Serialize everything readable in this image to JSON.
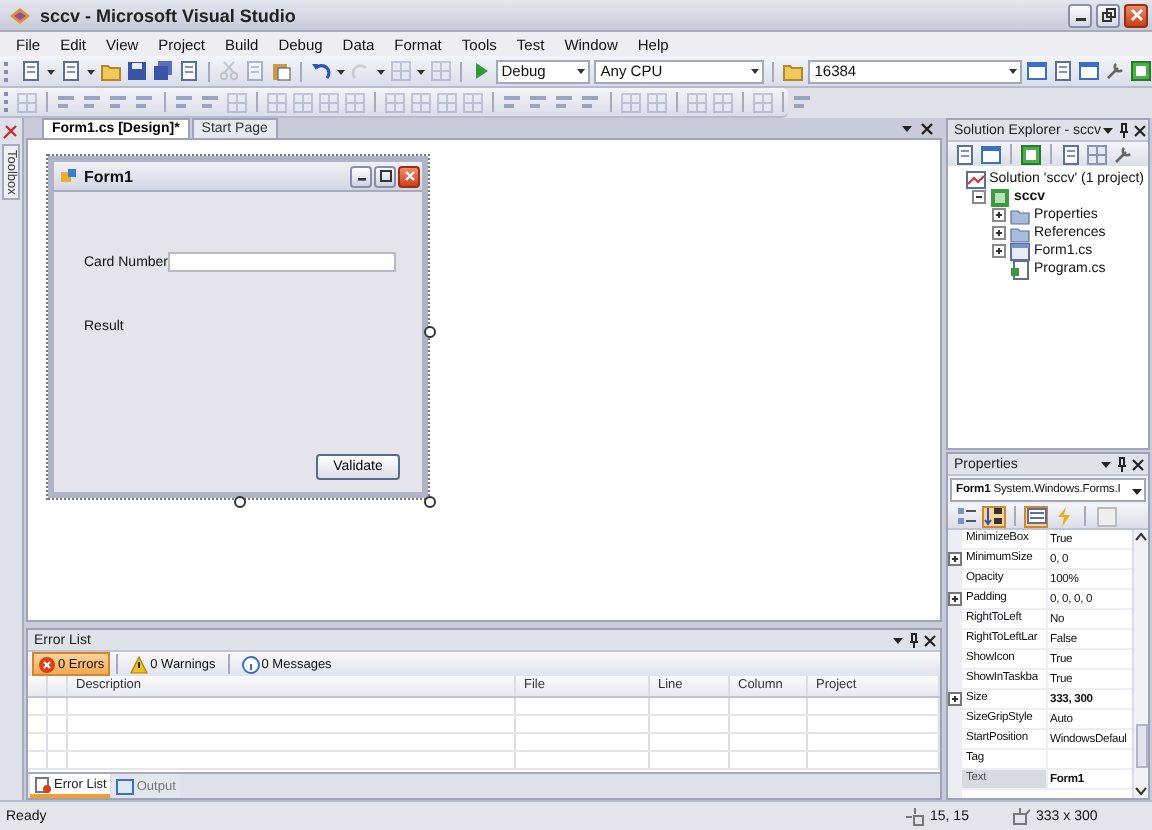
{
  "window": {
    "title": "sccv - Microsoft Visual Studio"
  },
  "menu": [
    "File",
    "Edit",
    "View",
    "Project",
    "Build",
    "Debug",
    "Data",
    "Format",
    "Tools",
    "Test",
    "Window",
    "Help"
  ],
  "toolbar": {
    "configuration": "Debug",
    "platform": "Any CPU",
    "find": "16384"
  },
  "toolbox": {
    "label": "Toolbox"
  },
  "document_tabs": [
    {
      "label": "Form1.cs [Design]*",
      "selected": true
    },
    {
      "label": "Start Page",
      "selected": false
    }
  ],
  "form": {
    "title": "Form1",
    "fields": [
      {
        "kind": "input",
        "label": "Card Number"
      },
      {
        "kind": "output",
        "label": "Result"
      }
    ],
    "button": "Validate"
  },
  "solution_explorer": {
    "title": "Solution Explorer - sccv",
    "tree": [
      {
        "label": "Solution 'sccv' (1 project)",
        "kind": "solution",
        "children": [
          {
            "label": "sccv",
            "kind": "project",
            "expanded": true,
            "children": [
              {
                "label": "Properties",
                "kind": "folder",
                "expanded": false
              },
              {
                "label": "References",
                "kind": "folder",
                "expanded": false
              },
              {
                "label": "Form1.cs",
                "kind": "form",
                "expanded": false
              },
              {
                "label": "Program.cs",
                "kind": "code"
              }
            ]
          }
        ]
      }
    ]
  },
  "properties": {
    "title": "Properties",
    "object_name": "Form1",
    "object_type": "System.Windows.Forms.I",
    "tools": [
      {
        "kind": "categorized",
        "selected": false
      },
      {
        "kind": "alphabetical",
        "selected": true
      },
      {
        "kind": "properties",
        "selected": true
      },
      {
        "kind": "events",
        "selected": false
      },
      {
        "kind": "pages",
        "selected": false
      }
    ],
    "rows": [
      {
        "name": "MinimizeBox",
        "value": "True",
        "expandable": false,
        "modified": false,
        "selected": false
      },
      {
        "name": "MinimumSize",
        "value": "0, 0",
        "expandable": true,
        "modified": false,
        "selected": false
      },
      {
        "name": "Opacity",
        "value": "100%",
        "expandable": false,
        "modified": false,
        "selected": false
      },
      {
        "name": "Padding",
        "value": "0, 0, 0, 0",
        "expandable": true,
        "modified": false,
        "selected": false
      },
      {
        "name": "RightToLeft",
        "value": "No",
        "expandable": false,
        "modified": false,
        "selected": false
      },
      {
        "name": "RightToLeftLar",
        "value": "False",
        "expandable": false,
        "modified": false,
        "selected": false
      },
      {
        "name": "ShowIcon",
        "value": "True",
        "expandable": false,
        "modified": false,
        "selected": false
      },
      {
        "name": "ShowInTaskba",
        "value": "True",
        "expandable": false,
        "modified": false,
        "selected": false
      },
      {
        "name": "Size",
        "value": "333, 300",
        "expandable": true,
        "modified": true,
        "selected": false
      },
      {
        "name": "SizeGripStyle",
        "value": "Auto",
        "expandable": false,
        "modified": false,
        "selected": false
      },
      {
        "name": "StartPosition",
        "value": "WindowsDefaul",
        "expandable": false,
        "modified": false,
        "selected": false
      },
      {
        "name": "Tag",
        "expandable": false,
        "selected": false
      },
      {
        "name": "Text",
        "value": "Form1",
        "expandable": false,
        "modified": true,
        "selected": true
      }
    ]
  },
  "error_list": {
    "title": "Error List",
    "filters": [
      {
        "label": "0 Errors",
        "kind": "error",
        "selected": true
      },
      {
        "label": "0 Warnings",
        "kind": "warning",
        "selected": false
      },
      {
        "label": "0 Messages",
        "kind": "info",
        "selected": false
      }
    ],
    "columns": [
      "Description",
      "File",
      "Line",
      "Column",
      "Project"
    ]
  },
  "bottom_tabs": [
    {
      "label": "Error List",
      "selected": true
    },
    {
      "label": "Output",
      "selected": false
    }
  ],
  "status_bar": {
    "text": "Ready",
    "position": "15, 15",
    "size": "333 x 300"
  }
}
